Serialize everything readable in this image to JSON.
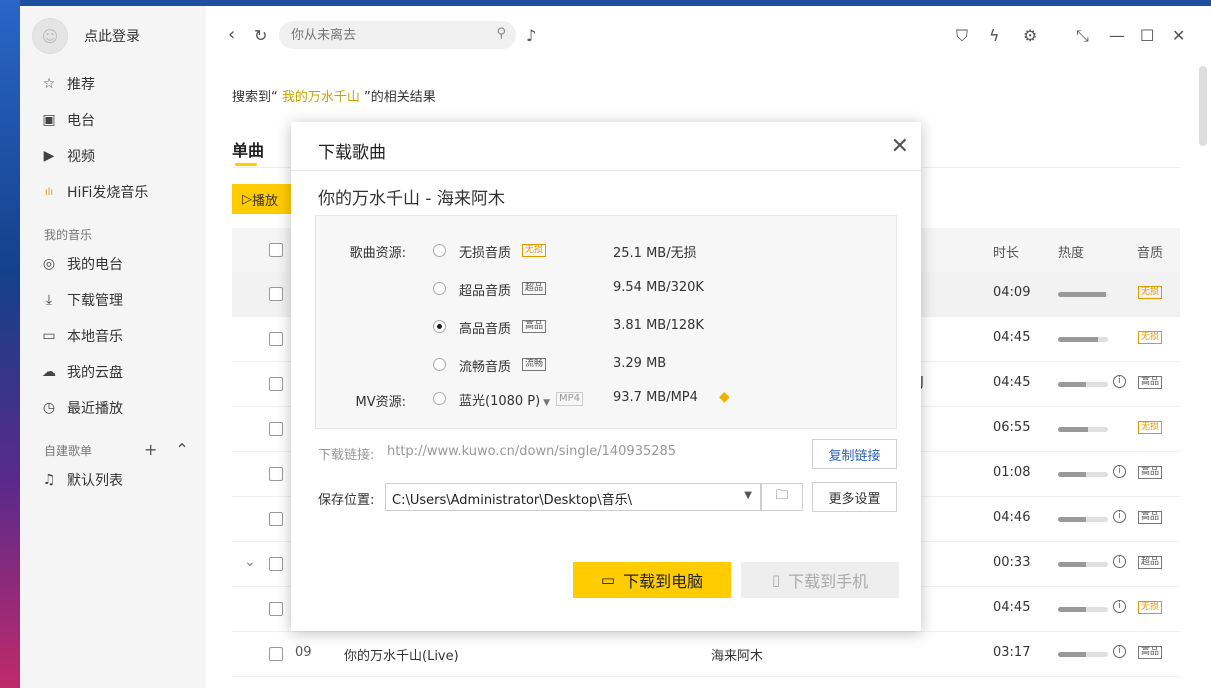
{
  "sidebar": {
    "login": "点此登录",
    "nav": [
      {
        "label": "推荐",
        "icon": "star-icon",
        "glyph": "☆"
      },
      {
        "label": "电台",
        "icon": "radio-icon",
        "glyph": "▣"
      },
      {
        "label": "视频",
        "icon": "video-icon",
        "glyph": "▶"
      },
      {
        "label": "HiFi发烧音乐",
        "icon": "hifi-icon",
        "glyph": "ılı"
      }
    ],
    "my_music_title": "我的音乐",
    "my_music": [
      {
        "label": "我的电台",
        "icon": "my-radio-icon",
        "glyph": "◎"
      },
      {
        "label": "下载管理",
        "icon": "download-icon",
        "glyph": "⤓"
      },
      {
        "label": "本地音乐",
        "icon": "local-music-icon",
        "glyph": "▭"
      },
      {
        "label": "我的云盘",
        "icon": "cloud-icon",
        "glyph": "☁"
      },
      {
        "label": "最近播放",
        "icon": "recent-icon",
        "glyph": "◷"
      }
    ],
    "playlists_title": "自建歌单",
    "playlists": [
      {
        "label": "默认列表",
        "icon": "playlist-icon",
        "glyph": "♫"
      }
    ]
  },
  "search": {
    "placeholder": "你从未离去"
  },
  "result": {
    "prefix": "搜索到“",
    "keyword": "我的万水千山",
    "suffix": "”的相关结果"
  },
  "tab": "单曲",
  "play_button": "播放",
  "table": {
    "headers": {
      "duration": "时长",
      "heat": "热度",
      "quality": "音质"
    },
    "rows": [
      {
        "num": "",
        "title": "",
        "artist": "",
        "extra": "",
        "duration": "04:09",
        "heat": 0.95,
        "info": false,
        "quality": "无损",
        "q": "lossless",
        "hl": true,
        "chev": false
      },
      {
        "num": "",
        "title": "",
        "artist": "",
        "extra": "",
        "duration": "04:45",
        "heat": 0.8,
        "info": false,
        "quality": "无损",
        "q": "lossless",
        "hl": false,
        "chev": false
      },
      {
        "num": "",
        "title": "",
        "artist": "",
        "extra": "J",
        "duration": "04:45",
        "heat": 0.55,
        "info": true,
        "quality": "高品",
        "q": "normal",
        "hl": false,
        "chev": false
      },
      {
        "num": "",
        "title": "",
        "artist": "",
        "extra": "",
        "duration": "06:55",
        "heat": 0.6,
        "info": false,
        "quality": "无损",
        "q": "lossless",
        "hl": false,
        "chev": false
      },
      {
        "num": "",
        "title": "",
        "artist": "",
        "extra": "",
        "duration": "01:08",
        "heat": 0.55,
        "info": true,
        "quality": "高品",
        "q": "normal",
        "hl": false,
        "chev": false
      },
      {
        "num": "",
        "title": "",
        "artist": "",
        "extra": "",
        "duration": "04:46",
        "heat": 0.55,
        "info": true,
        "quality": "高品",
        "q": "normal",
        "hl": false,
        "chev": false
      },
      {
        "num": "",
        "title": "",
        "artist": "",
        "extra": "",
        "duration": "00:33",
        "heat": 0.55,
        "info": true,
        "quality": "超品",
        "q": "normal",
        "hl": false,
        "chev": true
      },
      {
        "num": "",
        "title": "",
        "artist": "",
        "extra": "",
        "duration": "04:45",
        "heat": 0.55,
        "info": true,
        "quality": "无损",
        "q": "lossless",
        "hl": false,
        "chev": false
      },
      {
        "num": "09",
        "title": "你的万水千山(Live)",
        "artist": "海来阿木",
        "extra": "",
        "duration": "03:17",
        "heat": 0.55,
        "info": true,
        "quality": "高品",
        "q": "normal",
        "hl": false,
        "chev": false
      }
    ]
  },
  "dialog": {
    "title": "下载歌曲",
    "song": "你的万水千山  - 海来阿木",
    "source_label": "歌曲资源:",
    "qualities": [
      {
        "name": "无损音质",
        "tag": "无损",
        "lossless": true,
        "size": "25.1  MB/无损",
        "selected": false
      },
      {
        "name": "超品音质",
        "tag": "超品",
        "lossless": false,
        "size": "9.54 MB/320K",
        "selected": false
      },
      {
        "name": "高品音质",
        "tag": "高品",
        "lossless": false,
        "size": "3.81 MB/128K",
        "selected": true
      },
      {
        "name": "流畅音质",
        "tag": "流畅",
        "lossless": false,
        "size": "3.29 MB",
        "selected": false
      }
    ],
    "mv_label": "MV资源:",
    "mv_option": "蓝光(1080 P)",
    "mv_tag": "MP4",
    "mv_size": "93.7 MB/MP4",
    "link_label": "下载链接:",
    "link": "http://www.kuwo.cn/down/single/140935285",
    "copy_button": "复制链接",
    "save_label": "保存位置:",
    "save_path": "C:\\Users\\Administrator\\Desktop\\音乐\\",
    "more_button": "更多设置",
    "dl_pc": "下载到电脑",
    "dl_phone": "下载到手机"
  }
}
